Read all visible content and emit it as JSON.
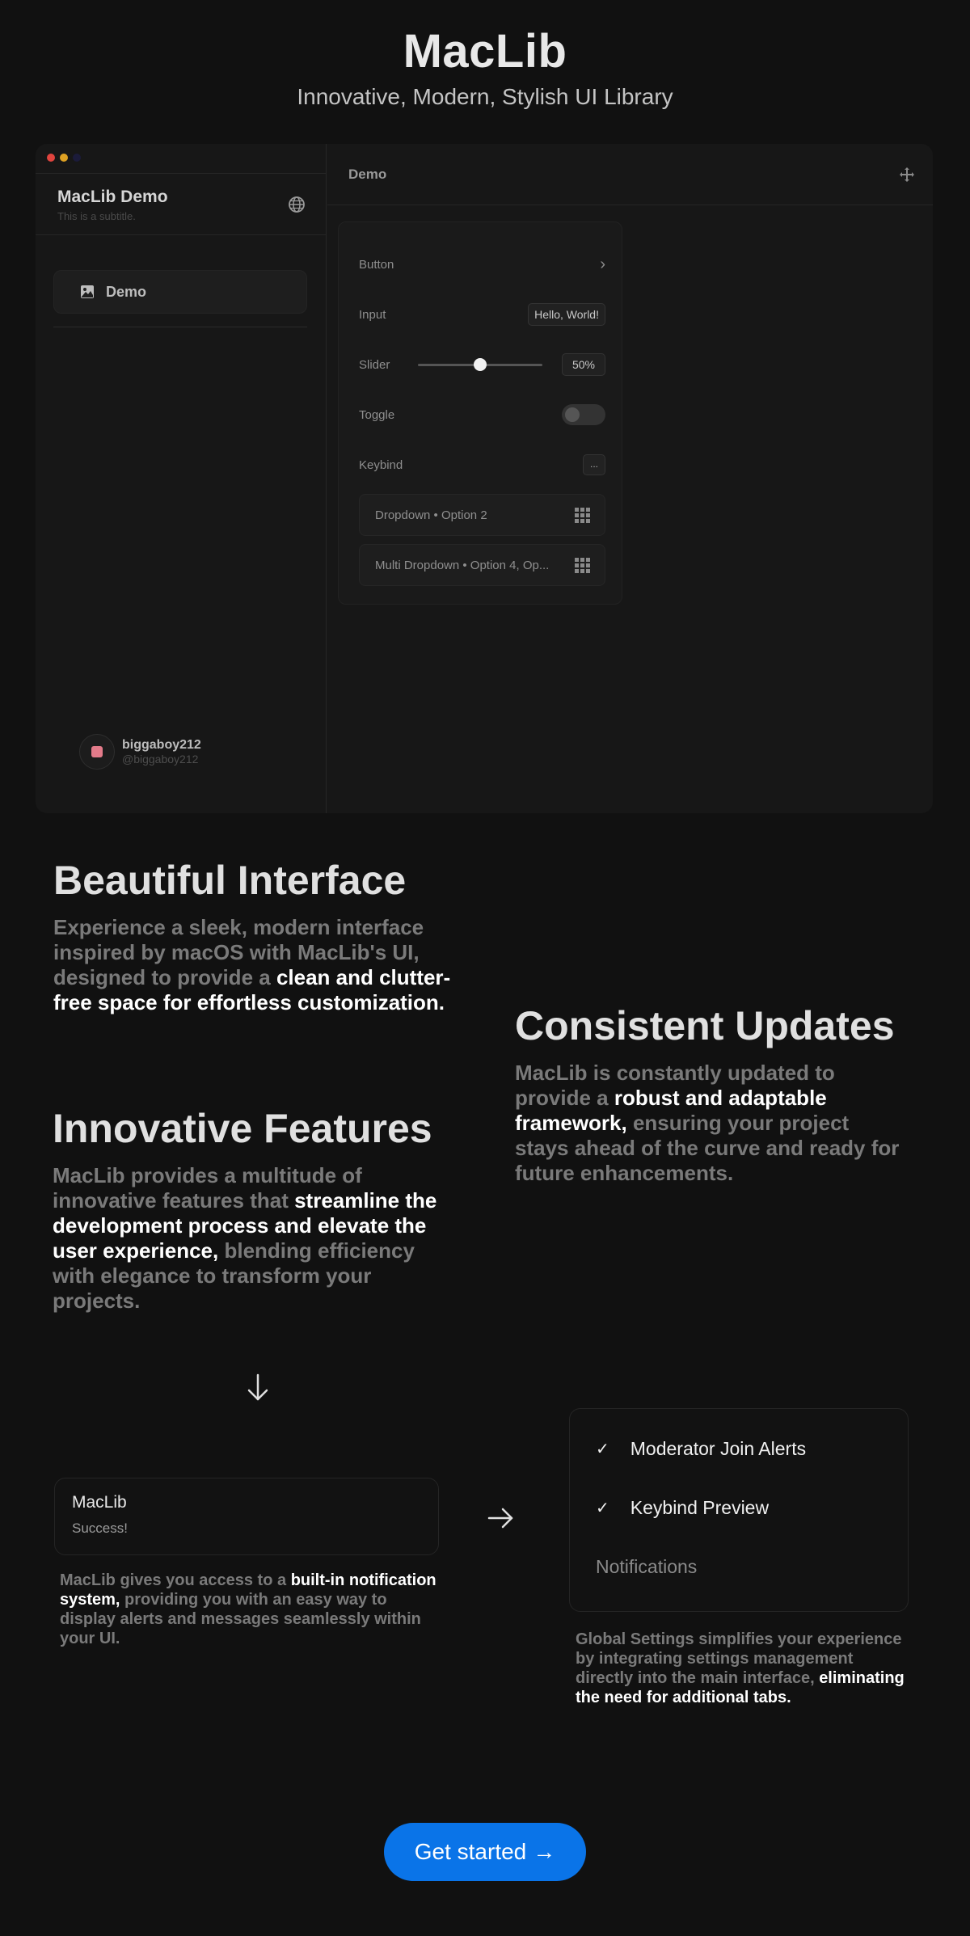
{
  "hero": {
    "title": "MacLib",
    "subtitle": "Innovative, Modern, Stylish UI Library"
  },
  "window": {
    "traffic_colors": [
      "#e0443e",
      "#dea123",
      "#1b1b3a"
    ],
    "sidebar": {
      "title": "MacLib Demo",
      "subtitle": "This is a subtitle.",
      "items": [
        {
          "label": "Demo",
          "icon": "image-icon"
        }
      ],
      "user": {
        "name": "biggaboy212",
        "handle": "@biggaboy212"
      }
    },
    "main": {
      "title": "Demo",
      "rows": {
        "button": "Button",
        "input": "Input",
        "input_value": "Hello, World!",
        "slider": "Slider",
        "slider_value": "50%",
        "toggle": "Toggle",
        "keybind": "Keybind",
        "keybind_value": "...",
        "dropdown": "Dropdown • Option 2",
        "multi_dropdown": "Multi Dropdown • Option 4, Op..."
      },
      "slider_fraction": 0.5,
      "toggle_on": false
    }
  },
  "features": {
    "beautiful": {
      "title": "Beautiful Interface",
      "body_a": "Experience a sleek, modern interface inspired by macOS with MacLib's UI, designed to provide a ",
      "body_hl": "clean and clutter-free space for effortless customization."
    },
    "updates": {
      "title": "Consistent Updates",
      "body_a": "MacLib is constantly updated to provide a ",
      "body_hl": "robust and adaptable framework,",
      "body_b": " ensuring your project stays ahead of the curve and ready for future enhancements."
    },
    "innovative": {
      "title": "Innovative Features",
      "body_a": "MacLib provides a multitude of innovative features that ",
      "body_hl": "streamline the development process and elevate the user experience,",
      "body_b": " blending efficiency with elegance to transform your projects."
    }
  },
  "notification": {
    "title": "MacLib",
    "message": "Success!",
    "desc_a": "MacLib gives you access to a ",
    "desc_hl": "built-in notification system,",
    "desc_b": " providing you with an easy way to display alerts and messages seamlessly within your UI."
  },
  "settings": {
    "items": [
      "Moderator Join Alerts",
      "Keybind Preview"
    ],
    "section": "Notifications",
    "desc_a": "Global Settings simplifies your experience by integrating settings management directly into the main interface, ",
    "desc_hl": "eliminating the need for additional tabs."
  },
  "cta": {
    "label": "Get started",
    "arrow": "→"
  },
  "colors": {
    "accent": "#0a74e8",
    "background": "#111111"
  }
}
